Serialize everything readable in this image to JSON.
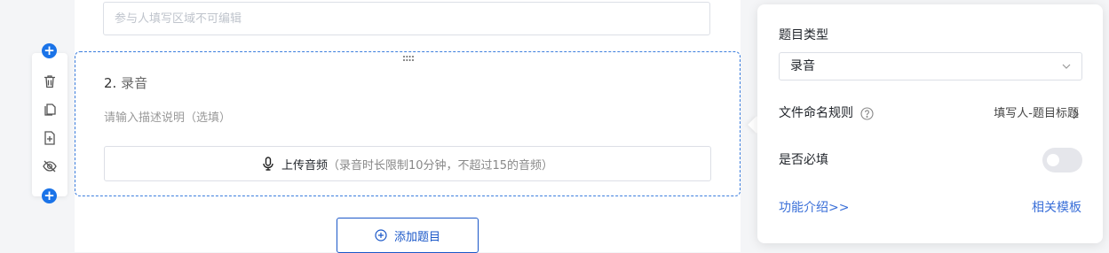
{
  "previous_question": {
    "input_placeholder": "参与人填写区域不可编辑"
  },
  "toolbar": {
    "icons": [
      "add-above-icon",
      "trash-icon",
      "copy-icon",
      "insert-icon",
      "hide-icon",
      "add-below-icon"
    ]
  },
  "question": {
    "number": "2.",
    "title": "录音",
    "description_placeholder": "请输入描述说明（选填）",
    "upload_label": "上传音频",
    "upload_hint": "（录音时长限制10分钟，不超过15的音频）"
  },
  "add_question_label": "添加题目",
  "panel": {
    "type_label": "题目类型",
    "type_value": "录音",
    "naming_label": "文件命名规则",
    "naming_value": "填写人-题目标题",
    "required_label": "是否必填",
    "required_on": false,
    "intro_link": "功能介绍>>",
    "template_link": "相关模板"
  },
  "colors": {
    "accent": "#1a73e8",
    "link": "#3a6fd8",
    "card_border": "#3b7ddd"
  }
}
